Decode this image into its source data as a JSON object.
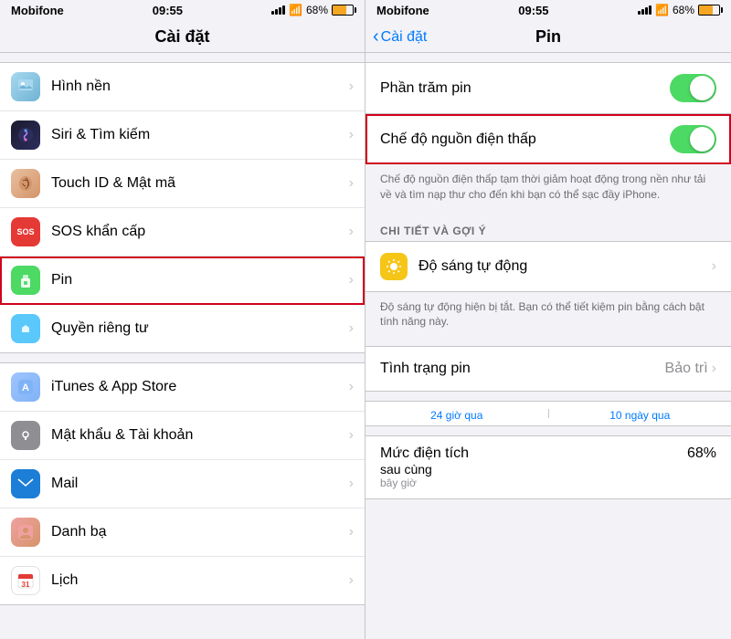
{
  "left": {
    "carrier": "Mobifone",
    "time": "09:55",
    "battery": "68%",
    "title": "Cài đặt",
    "items": [
      {
        "id": "wallpaper",
        "label": "Hình nền",
        "iconClass": "icon-wallpaper",
        "iconText": "🖼"
      },
      {
        "id": "siri",
        "label": "Siri & Tìm kiếm",
        "iconClass": "icon-siri",
        "iconText": "✦"
      },
      {
        "id": "touchid",
        "label": "Touch ID & Mật mã",
        "iconClass": "icon-touchid",
        "iconText": "👆"
      },
      {
        "id": "sos",
        "label": "SOS khẩn cấp",
        "iconClass": "icon-sos",
        "iconText": "SOS"
      },
      {
        "id": "pin",
        "label": "Pin",
        "iconClass": "icon-pin",
        "iconText": "🔋",
        "highlighted": true
      },
      {
        "id": "privacy",
        "label": "Quyền riêng tư",
        "iconClass": "icon-privacy",
        "iconText": "✋"
      },
      {
        "id": "itunes",
        "label": "iTunes & App Store",
        "iconClass": "icon-itunes",
        "iconText": "A"
      },
      {
        "id": "password",
        "label": "Mật khẩu & Tài khoản",
        "iconClass": "icon-password",
        "iconText": "🔑"
      },
      {
        "id": "mail",
        "label": "Mail",
        "iconClass": "icon-mail",
        "iconText": "✉"
      },
      {
        "id": "contacts",
        "label": "Danh bạ",
        "iconClass": "icon-contacts",
        "iconText": "👤"
      },
      {
        "id": "calendar",
        "label": "Lịch",
        "iconClass": "icon-calendar",
        "iconText": "📅"
      }
    ]
  },
  "right": {
    "carrier": "Mobifone",
    "time": "09:55",
    "battery": "68%",
    "back_label": "Cài đặt",
    "title": "Pin",
    "sections": {
      "phan_tram": {
        "label": "Phần trăm pin",
        "toggle": true
      },
      "che_do": {
        "label": "Chế độ nguồn điện thấp",
        "toggle": true,
        "highlighted": true,
        "description": "Chế độ nguồn điện thấp tạm thời giảm hoạt động trong nền như tải về và tìm nạp thư cho đến khi bạn có thể sạc đầy iPhone."
      },
      "section_header": "CHI TIẾT VÀ GỢI Ý",
      "do_sang": {
        "label": "Độ sáng tự động",
        "icon": "💡",
        "description": "Độ sáng tự động hiện bị tắt. Bạn có thể tiết kiệm pin bằng cách bật tính năng này."
      },
      "tinh_trang": {
        "label": "Tình trạng pin",
        "value": "Bảo trì"
      },
      "tabs": {
        "tab1": "24 giờ qua",
        "tab2": "10 ngày qua"
      },
      "muc_dien_tich": {
        "label": "Mức điện tích",
        "sublabel": "sau cùng",
        "sublabel2": "bây giờ",
        "value": "68%"
      }
    }
  }
}
